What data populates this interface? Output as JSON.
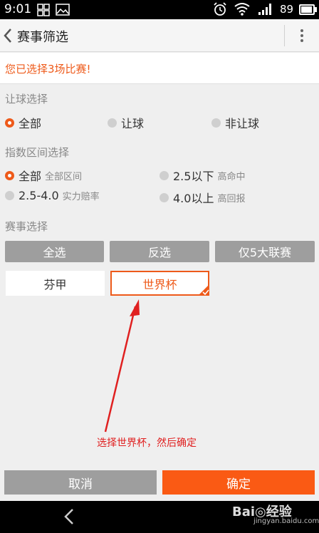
{
  "status_bar": {
    "time": "9:01",
    "battery_level": "89"
  },
  "header": {
    "title": "赛事筛选"
  },
  "notice": {
    "text": "您已选择3场比赛!"
  },
  "handicap": {
    "label": "让球选择",
    "options": [
      {
        "label": "全部",
        "selected": true
      },
      {
        "label": "让球",
        "selected": false
      },
      {
        "label": "非让球",
        "selected": false
      }
    ]
  },
  "index_range": {
    "label": "指数区间选择",
    "options": [
      {
        "label": "全部",
        "sub": "全部区间",
        "selected": true
      },
      {
        "label": "2.5以下",
        "sub": "高命中",
        "selected": false
      },
      {
        "label": "2.5-4.0",
        "sub": "实力赔率",
        "selected": false
      },
      {
        "label": "4.0以上",
        "sub": "高回报",
        "selected": false
      }
    ]
  },
  "league": {
    "label": "赛事选择",
    "buttons": {
      "select_all": "全选",
      "invert": "反选",
      "top5": "仅5大联赛"
    },
    "items": [
      {
        "label": "芬甲",
        "selected": false
      },
      {
        "label": "世界杯",
        "selected": true
      }
    ]
  },
  "annotation": {
    "text": "选择世界杯，然后确定"
  },
  "footer": {
    "cancel": "取消",
    "confirm": "确定"
  },
  "watermark": {
    "brand": "Bai◎经验",
    "url": "jingyan.baidu.com"
  },
  "colors": {
    "accent": "#ee5a1a",
    "confirm": "#fa5a14",
    "gray_button": "#9e9e9e",
    "annotation": "#e02020"
  }
}
